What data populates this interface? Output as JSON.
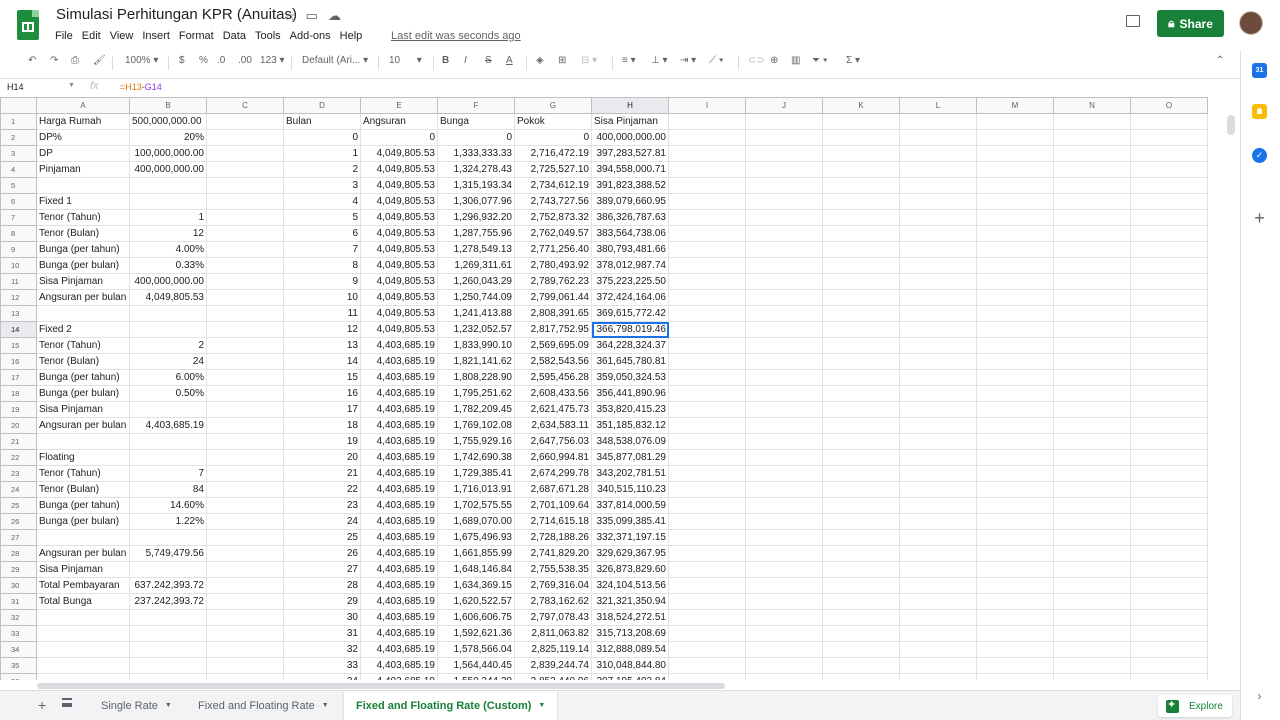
{
  "app": {
    "title": "Simulasi Perhitungan KPR (Anuitas)",
    "last_edit": "Last edit was seconds ago",
    "share_label": "Share",
    "menu": [
      "File",
      "Edit",
      "View",
      "Insert",
      "Format",
      "Data",
      "Tools",
      "Add-ons",
      "Help"
    ]
  },
  "toolbar": {
    "zoom": "100%",
    "currency": "$",
    "percent": "%",
    "dec_decrease": ".0",
    "dec_increase": ".00",
    "more_formats": "123",
    "font": "Default (Ari...",
    "font_size": "10"
  },
  "formula_bar": {
    "cell": "H14",
    "ref1": "=H13",
    "op": "-",
    "ref2": "G14"
  },
  "grid": {
    "columns": [
      "A",
      "B",
      "C",
      "D",
      "E",
      "F",
      "G",
      "H",
      "I",
      "J",
      "K",
      "L",
      "M",
      "N",
      "O"
    ],
    "active_col": "H",
    "active_row": "14",
    "rows": [
      {
        "n": "1",
        "A": "Harga Rumah",
        "B": "500,000,000.00",
        "D": "Bulan",
        "E": "Angsuran",
        "F": "Bunga",
        "G": "Pokok",
        "H": "Sisa Pinjaman"
      },
      {
        "n": "2",
        "A": "DP%",
        "B": "20%",
        "D": "0",
        "E": "0",
        "F": "0",
        "G": "0",
        "H": "400,000,000.00"
      },
      {
        "n": "3",
        "A": "DP",
        "B": "100,000,000.00",
        "D": "1",
        "E": "4,049,805.53",
        "F": "1,333,333.33",
        "G": "2,716,472.19",
        "H": "397,283,527.81"
      },
      {
        "n": "4",
        "A": "Pinjaman",
        "B": "400,000,000.00",
        "D": "2",
        "E": "4,049,805.53",
        "F": "1,324,278.43",
        "G": "2,725,527.10",
        "H": "394,558,000.71"
      },
      {
        "n": "5",
        "D": "3",
        "E": "4,049,805.53",
        "F": "1,315,193.34",
        "G": "2,734,612.19",
        "H": "391,823,388.52"
      },
      {
        "n": "6",
        "A": "Fixed 1",
        "D": "4",
        "E": "4,049,805.53",
        "F": "1,306,077.96",
        "G": "2,743,727.56",
        "H": "389,079,660.95"
      },
      {
        "n": "7",
        "A": "Tenor (Tahun)",
        "B": "1",
        "D": "5",
        "E": "4,049,805.53",
        "F": "1,296,932.20",
        "G": "2,752,873.32",
        "H": "386,326,787.63"
      },
      {
        "n": "8",
        "A": "Tenor (Bulan)",
        "B": "12",
        "D": "6",
        "E": "4,049,805.53",
        "F": "1,287,755.96",
        "G": "2,762,049.57",
        "H": "383,564,738.06"
      },
      {
        "n": "9",
        "A": "Bunga (per tahun)",
        "B": "4.00%",
        "D": "7",
        "E": "4,049,805.53",
        "F": "1,278,549.13",
        "G": "2,771,256.40",
        "H": "380,793,481.66"
      },
      {
        "n": "10",
        "A": "Bunga (per bulan)",
        "B": "0.33%",
        "D": "8",
        "E": "4,049,805.53",
        "F": "1,269,311.61",
        "G": "2,780,493.92",
        "H": "378,012,987.74"
      },
      {
        "n": "11",
        "A": "Sisa Pinjaman",
        "B": "400,000,000.00",
        "D": "9",
        "E": "4,049,805.53",
        "F": "1,260,043.29",
        "G": "2,789,762.23",
        "H": "375,223,225.50"
      },
      {
        "n": "12",
        "A": "Angsuran per bulan",
        "B": "4,049,805.53",
        "D": "10",
        "E": "4,049,805.53",
        "F": "1,250,744.09",
        "G": "2,799,061.44",
        "H": "372,424,164.06"
      },
      {
        "n": "13",
        "D": "11",
        "E": "4,049,805.53",
        "F": "1,241,413.88",
        "G": "2,808,391.65",
        "H": "369,615,772.42"
      },
      {
        "n": "14",
        "A": "Fixed 2",
        "D": "12",
        "E": "4,049,805.53",
        "F": "1,232,052.57",
        "G": "2,817,752.95",
        "H": "366,798,019.46"
      },
      {
        "n": "15",
        "A": "Tenor (Tahun)",
        "B": "2",
        "D": "13",
        "E": "4,403,685.19",
        "F": "1,833,990.10",
        "G": "2,569,695.09",
        "H": "364,228,324.37"
      },
      {
        "n": "16",
        "A": "Tenor (Bulan)",
        "B": "24",
        "D": "14",
        "E": "4,403,685.19",
        "F": "1,821,141.62",
        "G": "2,582,543.56",
        "H": "361,645,780.81"
      },
      {
        "n": "17",
        "A": "Bunga (per tahun)",
        "B": "6.00%",
        "D": "15",
        "E": "4,403,685.19",
        "F": "1,808,228.90",
        "G": "2,595,456.28",
        "H": "359,050,324.53"
      },
      {
        "n": "18",
        "A": "Bunga (per bulan)",
        "B": "0.50%",
        "D": "16",
        "E": "4,403,685.19",
        "F": "1,795,251.62",
        "G": "2,608,433.56",
        "H": "356,441,890.96"
      },
      {
        "n": "19",
        "A": "Sisa Pinjaman",
        "D": "17",
        "E": "4,403,685.19",
        "F": "1,782,209.45",
        "G": "2,621,475.73",
        "H": "353,820,415.23"
      },
      {
        "n": "20",
        "A": "Angsuran per bulan",
        "B": "4,403,685.19",
        "D": "18",
        "E": "4,403,685.19",
        "F": "1,769,102.08",
        "G": "2,634,583.11",
        "H": "351,185,832.12"
      },
      {
        "n": "21",
        "D": "19",
        "E": "4,403,685.19",
        "F": "1,755,929.16",
        "G": "2,647,756.03",
        "H": "348,538,076.09"
      },
      {
        "n": "22",
        "A": "Floating",
        "D": "20",
        "E": "4,403,685.19",
        "F": "1,742,690.38",
        "G": "2,660,994.81",
        "H": "345,877,081.29"
      },
      {
        "n": "23",
        "A": "Tenor (Tahun)",
        "B": "7",
        "D": "21",
        "E": "4,403,685.19",
        "F": "1,729,385.41",
        "G": "2,674,299.78",
        "H": "343,202,781.51"
      },
      {
        "n": "24",
        "A": "Tenor (Bulan)",
        "B": "84",
        "D": "22",
        "E": "4,403,685.19",
        "F": "1,716,013.91",
        "G": "2,687,671.28",
        "H": "340,515,110.23"
      },
      {
        "n": "25",
        "A": "Bunga (per tahun)",
        "B": "14.60%",
        "D": "23",
        "E": "4,403,685.19",
        "F": "1,702,575.55",
        "G": "2,701,109.64",
        "H": "337,814,000.59"
      },
      {
        "n": "26",
        "A": "Bunga (per bulan)",
        "B": "1.22%",
        "D": "24",
        "E": "4,403,685.19",
        "F": "1,689,070.00",
        "G": "2,714,615.18",
        "H": "335,099,385.41"
      },
      {
        "n": "27",
        "D": "25",
        "E": "4,403,685.19",
        "F": "1,675,496.93",
        "G": "2,728,188.26",
        "H": "332,371,197.15"
      },
      {
        "n": "28",
        "A": "Angsuran per bulan",
        "B": "5,749,479.56",
        "D": "26",
        "E": "4,403,685.19",
        "F": "1,661,855.99",
        "G": "2,741,829.20",
        "H": "329,629,367.95"
      },
      {
        "n": "29",
        "A": "Sisa Pinjaman",
        "D": "27",
        "E": "4,403,685.19",
        "F": "1,648,146.84",
        "G": "2,755,538.35",
        "H": "326,873,829.60"
      },
      {
        "n": "30",
        "A": "Total Pembayaran",
        "B": "637.242,393.72",
        "D": "28",
        "E": "4,403,685.19",
        "F": "1,634,369.15",
        "G": "2,769,316.04",
        "H": "324,104,513.56"
      },
      {
        "n": "31",
        "A": "Total Bunga",
        "B": "237.242,393.72",
        "D": "29",
        "E": "4,403,685.19",
        "F": "1,620,522.57",
        "G": "2,783,162.62",
        "H": "321,321,350.94"
      },
      {
        "n": "32",
        "D": "30",
        "E": "4,403,685.19",
        "F": "1,606,606.75",
        "G": "2,797,078.43",
        "H": "318,524,272.51"
      },
      {
        "n": "33",
        "D": "31",
        "E": "4,403,685.19",
        "F": "1,592,621.36",
        "G": "2,811,063.82",
        "H": "315,713,208.69"
      },
      {
        "n": "34",
        "D": "32",
        "E": "4,403,685.19",
        "F": "1,578,566.04",
        "G": "2,825,119.14",
        "H": "312,888,089.54"
      },
      {
        "n": "35",
        "D": "33",
        "E": "4,403,685.19",
        "F": "1,564,440.45",
        "G": "2,839,244.74",
        "H": "310,048,844.80"
      },
      {
        "n": "36",
        "D": "34",
        "E": "4,403,685.19",
        "F": "1,550,244.20",
        "G": "2,853,440.96",
        "H": "307,195,403.84"
      }
    ]
  },
  "tabs": {
    "items": [
      "Single Rate",
      "Fixed and Floating Rate",
      "Fixed and Floating Rate (Custom)"
    ],
    "active": "Fixed and Floating Rate (Custom)",
    "explore_label": "Explore"
  },
  "side_panel": {
    "calendar_label": "31"
  },
  "colors": {
    "brand_green": "#188038",
    "selection_blue": "#1a73e8"
  }
}
